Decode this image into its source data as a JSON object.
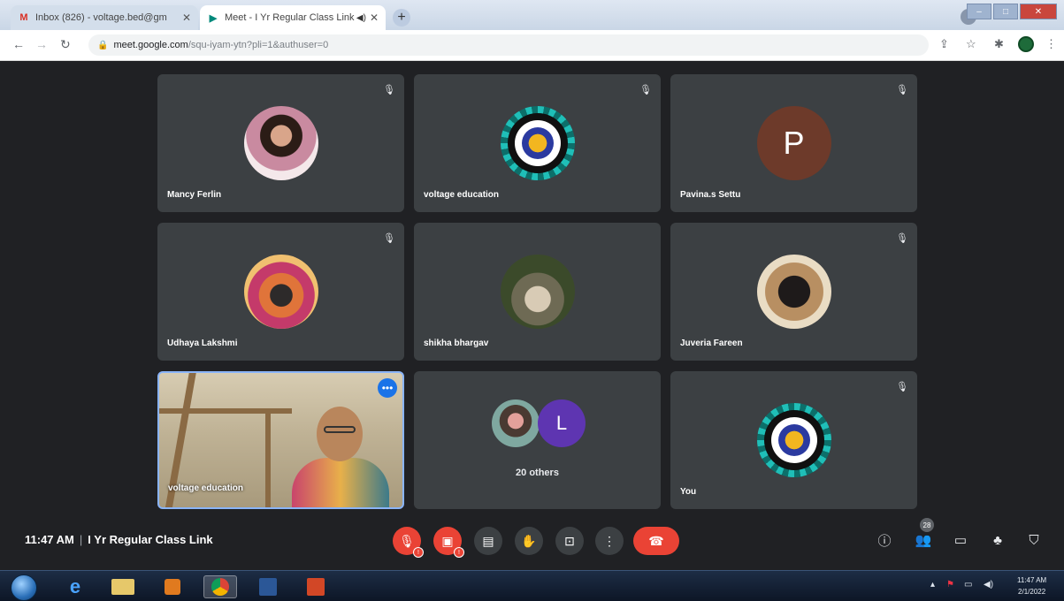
{
  "browser": {
    "tabs": [
      {
        "favicon": "gmail-icon",
        "title": "Inbox (826) - voltage.bed@gm",
        "active": false
      },
      {
        "favicon": "meet-icon",
        "title": "Meet - I Yr Regular Class Link",
        "active": true
      }
    ],
    "url_host": "meet.google.com",
    "url_path": "/squ-iyam-ytn?pli=1&authuser=0"
  },
  "tiles": [
    {
      "name": "Mancy Ferlin",
      "avatar": "photo"
    },
    {
      "name": "voltage education",
      "avatar": "logo"
    },
    {
      "name": "Pavina.s Settu",
      "avatar": "letter",
      "letter": "P"
    },
    {
      "name": "Udhaya Lakshmi",
      "avatar": "photo"
    },
    {
      "name": "shikha bhargav",
      "avatar": "photo"
    },
    {
      "name": "Juveria Fareen",
      "avatar": "photo"
    },
    {
      "name": "voltage education",
      "avatar": "video"
    },
    {
      "name": "You",
      "avatar": "logo"
    }
  ],
  "others": {
    "letter": "L",
    "label": "20 others"
  },
  "meeting": {
    "time": "11:47 AM",
    "title": "I Yr Regular Class Link",
    "participant_count": "28",
    "mic_badge": "!",
    "cam_badge": "!"
  },
  "taskbar": {
    "time": "11:47 AM",
    "date": "2/1/2022"
  },
  "colors": {
    "background": "#202124",
    "tile": "#3c4043",
    "red": "#ea4335",
    "blue": "#1a73e8"
  }
}
